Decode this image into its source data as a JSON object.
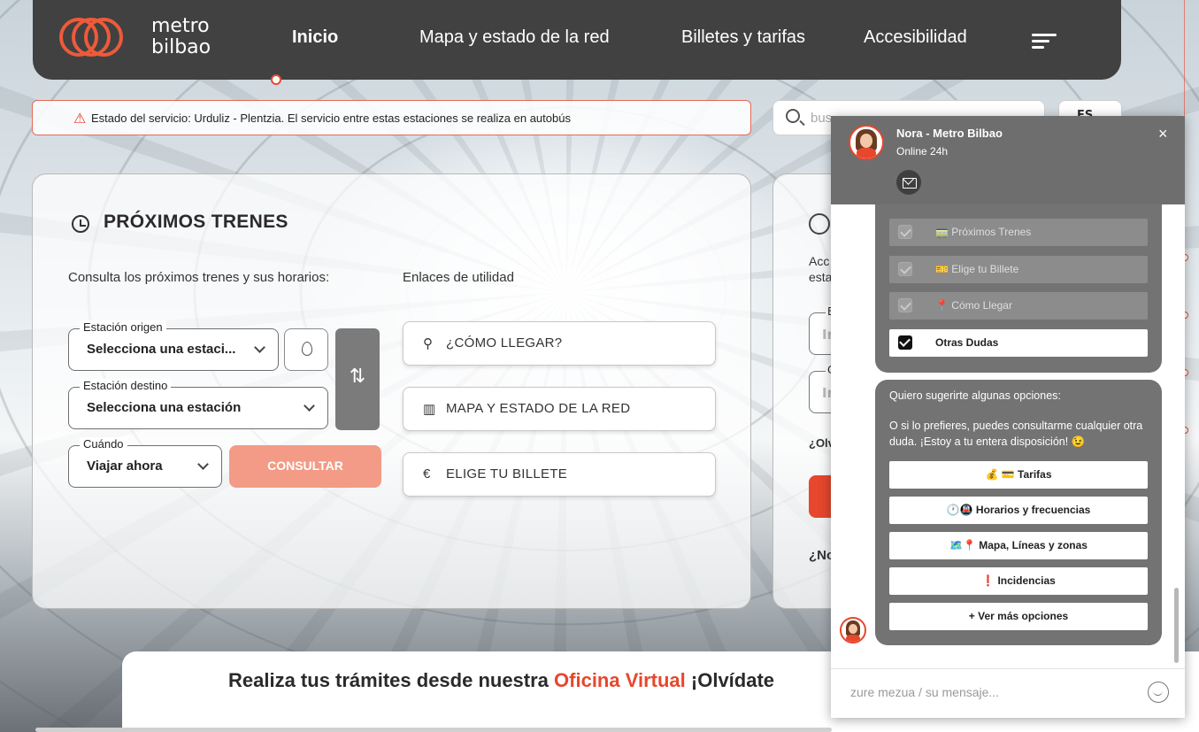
{
  "header": {
    "brand_line1": "metro",
    "brand_line2": "bilbao",
    "nav": [
      {
        "label": "Inicio",
        "active": true
      },
      {
        "label": "Mapa y estado de la red"
      },
      {
        "label": "Billetes y tarifas"
      },
      {
        "label": "Accesibilidad"
      }
    ],
    "menu_icon": "hamburger-icon"
  },
  "alert": {
    "label": "Estado del servicio:",
    "text": "Urduliz - Plentzia. El servicio entre estas estaciones se realiza en autobús",
    "icon": "warning-icon"
  },
  "search": {
    "placeholder": "bus"
  },
  "language": {
    "value": "ES"
  },
  "trains": {
    "title": "PRÓXIMOS TRENES",
    "subtitle": "Consulta los próximos trenes y sus horarios:",
    "links_title": "Enlaces de utilidad",
    "origin": {
      "label": "Estación origen",
      "value": "Selecciona una estaci..."
    },
    "destination": {
      "label": "Estación destino",
      "value": "Selecciona una estación"
    },
    "when": {
      "label": "Cuándo",
      "value": "Viajar ahora"
    },
    "swap_icon": "⇅",
    "consult_label": "CONSULTAR",
    "links": [
      {
        "icon": "⚲",
        "label": "¿CÓMO LLEGAR?"
      },
      {
        "icon": "▥",
        "label": "MAPA Y ESTADO DE LA RED"
      },
      {
        "icon": "€",
        "label": "ELIGE TU BILLETE"
      }
    ]
  },
  "side_card": {
    "line1": "Acc",
    "line2": "esta",
    "field1_label": "E",
    "field1_value": "In",
    "field2_label": "C",
    "field2_value": "In",
    "link_text": "¿Olv",
    "bottom_text": "¿No"
  },
  "banner": {
    "text_before": "Realiza tus trámites desde nuestra ",
    "highlight": "Oficina Virtual",
    "text_after": " ¡Olvídate"
  },
  "chat": {
    "name": "Nora - Metro Bilbao",
    "status": "Online 24h",
    "close": "×",
    "menu_options": [
      {
        "label": "🚃 Próximos Trenes",
        "checked": true,
        "disabled": true
      },
      {
        "label": "🎫 Elige tu Billete",
        "checked": true,
        "disabled": true
      },
      {
        "label": "📍 Cómo Llegar",
        "checked": true,
        "disabled": true
      },
      {
        "label": "Otras Dudas",
        "checked": true,
        "disabled": false
      }
    ],
    "message_line1": "Quiero sugerirte algunas opciones:",
    "message_line2": "O si lo prefieres, puedes consultarme cualquier otra duda. ¡Estoy a tu entera disposición! 😉",
    "quick_replies": [
      "💰 💳 Tarifas",
      "🕐🚇 Horarios y frecuencias",
      "🗺️📍 Mapa, Líneas y zonas",
      "❗ Incidencias",
      "+ Ver más opciones"
    ],
    "input_placeholder": "zure mezua / su mensaje..."
  },
  "colors": {
    "accent": "#e6472d",
    "nav_bg": "#414141",
    "chat_header": "#6e6e6e",
    "bubble": "#737373"
  }
}
